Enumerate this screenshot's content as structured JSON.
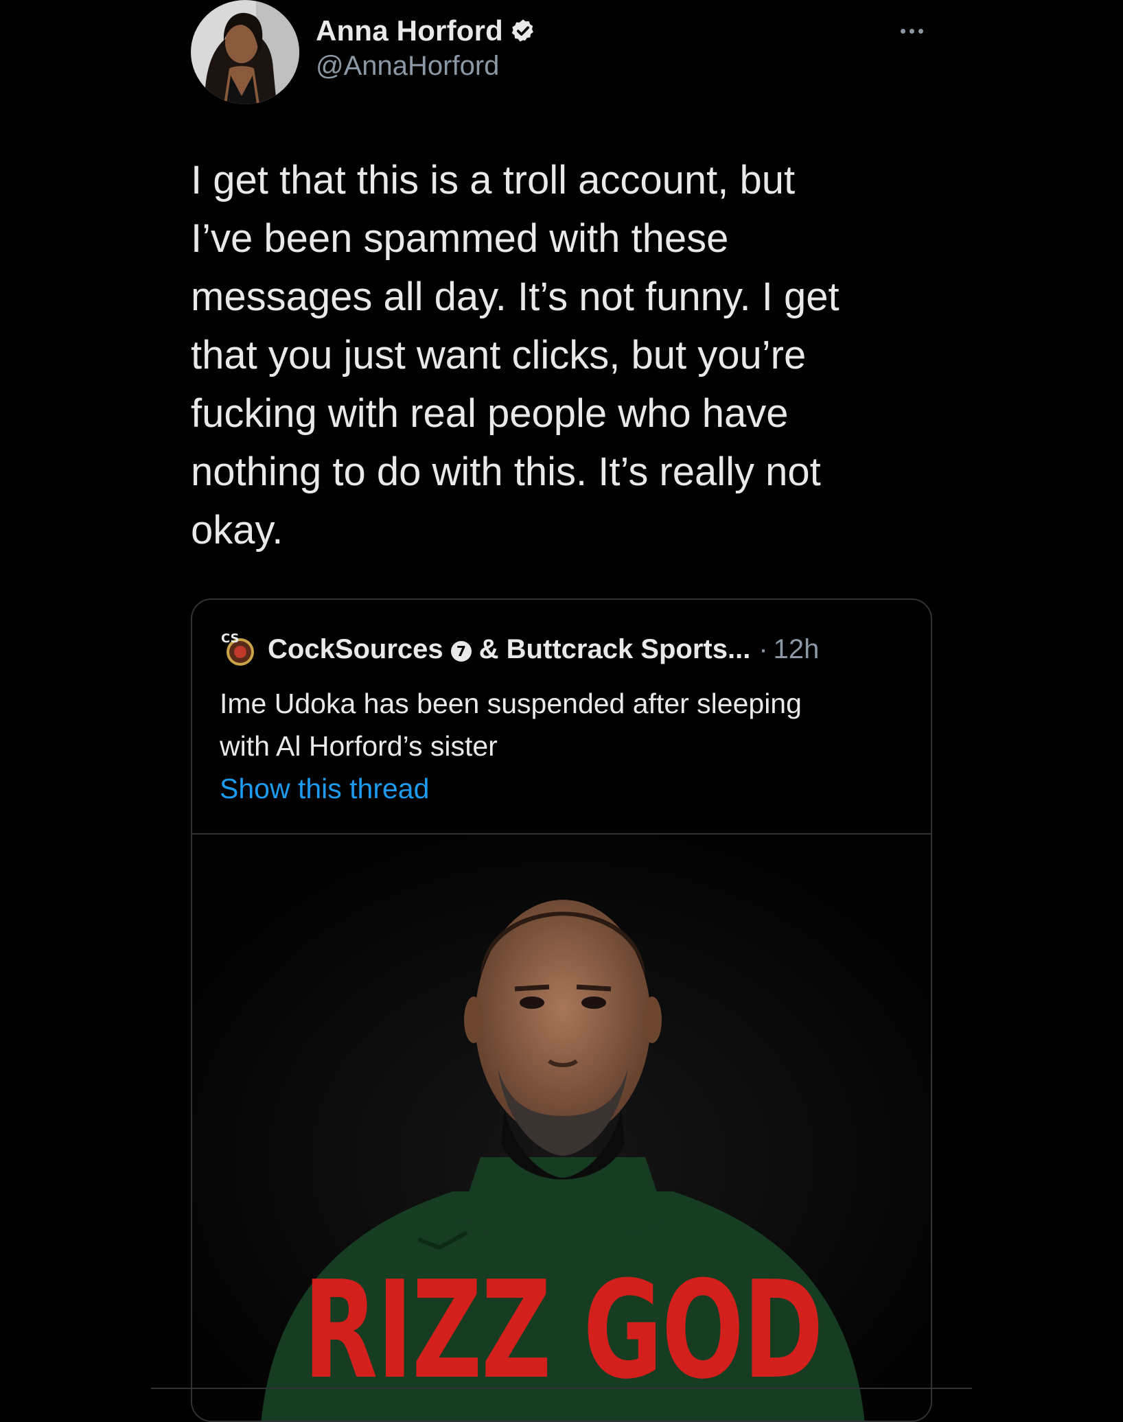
{
  "tweet": {
    "author": {
      "display_name": "Anna Horford",
      "handle": "@AnnaHorford",
      "verified": true
    },
    "text": "I get that this is a troll account, but\nI’ve been spammed with these\nmessages all day. It’s not funny. I get\nthat you just want clicks, but you’re\nfucking with real people who have\nnothing to do with this. It’s really not\nokay."
  },
  "quote": {
    "authors": "CockSources",
    "badge_number": "7",
    "authors_more": "& Buttcrack Sports...",
    "separator": "·",
    "time": "12h",
    "avatar_label": "CS",
    "text": "Ime Udoka has been suspended after sleeping\nwith Al Horford’s sister",
    "show_thread": "Show this thread",
    "media_caption": "RIZZ GOD"
  },
  "colors": {
    "background": "#000000",
    "text": "#e7e9ea",
    "muted": "#8b98a5",
    "link": "#1d9bf0",
    "border": "#2f3336",
    "caption_red": "#d4201c"
  }
}
